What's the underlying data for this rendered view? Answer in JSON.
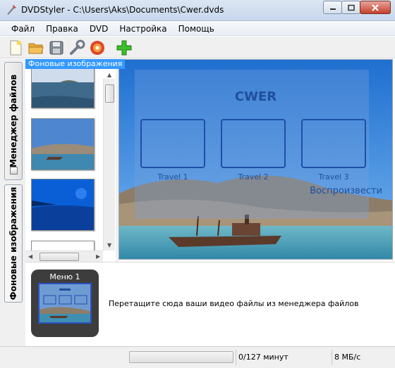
{
  "window": {
    "title": "DVDStyler - C:\\Users\\Aks\\Documents\\Cwer.dvds"
  },
  "menubar": {
    "items": [
      "Файл",
      "Правка",
      "DVD",
      "Настройка",
      "Помощь"
    ]
  },
  "toolbar": {
    "buttons": [
      "new-icon",
      "open-icon",
      "save-icon",
      "settings-icon",
      "burn-icon",
      "add-icon"
    ]
  },
  "tabs": {
    "file_manager": "Менеджер файлов",
    "backgrounds": "Фоновые изображения"
  },
  "background_panel": {
    "header": "Фоновые изображения"
  },
  "preview": {
    "menu_title": "CWER",
    "buttons": [
      "Travel 1",
      "Travel 2",
      "Travel 3"
    ],
    "play_label": "Воспроизвести"
  },
  "menus": {
    "card_label": "Меню 1",
    "drop_hint": "Перетащите сюда ваши видео файлы из менеджера файлов"
  },
  "statusbar": {
    "duration": "0/127 минут",
    "rate": "8 МБ/с"
  },
  "colors": {
    "selection": "#3399ff",
    "menu_text": "#1f4f9c"
  }
}
